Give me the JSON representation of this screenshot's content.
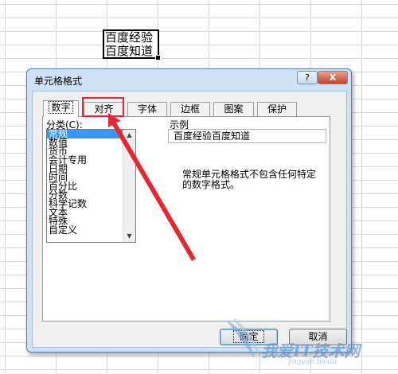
{
  "sheet": {
    "cell_lines": [
      "百度经验",
      "百度知道"
    ]
  },
  "dialog": {
    "title": "单元格格式",
    "help_label": "?",
    "close_label": "X",
    "tabs": [
      {
        "label": "数字",
        "active": true
      },
      {
        "label": "对齐",
        "active": false
      },
      {
        "label": "字体",
        "active": false
      },
      {
        "label": "边框",
        "active": false
      },
      {
        "label": "图案",
        "active": false
      },
      {
        "label": "保护",
        "active": false
      }
    ],
    "category_label": "分类(C):",
    "categories": [
      "常规",
      "数值",
      "货币",
      "会计专用",
      "日期",
      "时间",
      "百分比",
      "分数",
      "科学记数",
      "文本",
      "特殊",
      "自定义"
    ],
    "selected_category": "常规",
    "sample_label": "示例",
    "sample_value": "百度经验百度知道",
    "description_lines": [
      "常规单元格格式不包含任何特定",
      "的数字格式。"
    ],
    "ok_label": "确定",
    "cancel_label": "取消"
  },
  "annotation": {
    "highlight_color": "#e8262f",
    "arrow_color": "#e8262f"
  },
  "watermark": {
    "text": "我爱IT技术网",
    "url": "jingyan.baidu"
  }
}
